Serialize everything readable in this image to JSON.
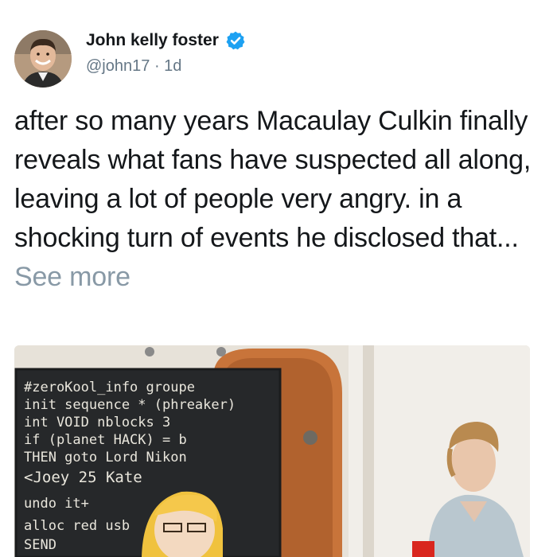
{
  "author": {
    "display_name": "John kelly foster",
    "verified_icon": "verified-badge-icon",
    "handle": "@john17",
    "separator": "·",
    "timestamp": "1d"
  },
  "tweet": {
    "text": "after so many years Macaulay Culkin finally reveals what fans have suspected all along, leaving a lot of people very angry. in a shocking turn of events he disclosed that...",
    "see_more": "See more"
  },
  "media": {
    "chalkboard_lines": [
      "#zeroKool_info groupe",
      "init sequence * (phreaker)",
      "int VOID nblocks     3",
      "if (planet HACK) = b",
      "THEN goto Lord Nikon",
      "<Joey 25          Kate",
      "undo it+",
      "alloc red           usb",
      "SEND"
    ]
  },
  "colors": {
    "text": "#14171a",
    "secondary": "#657786",
    "see_more": "#8899a6",
    "verified": "#1da1f2"
  }
}
